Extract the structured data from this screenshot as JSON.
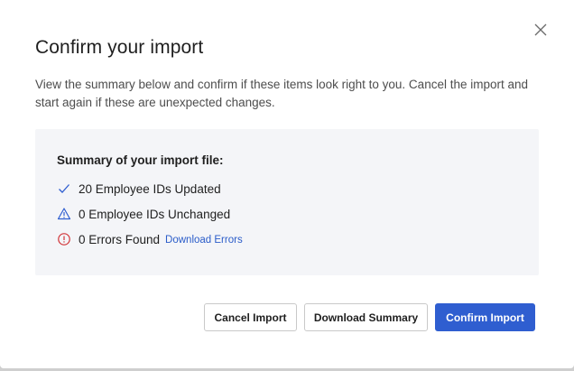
{
  "dialog": {
    "title": "Confirm your import",
    "description": "View the summary below and confirm if these items look right to you. Cancel the import and start again if these are unexpected changes.",
    "close_icon": "close-icon"
  },
  "summary": {
    "heading": "Summary of your import file:",
    "rows": [
      {
        "icon": "check-icon",
        "text": "20 Employee IDs Updated",
        "color": "#2f5ed0"
      },
      {
        "icon": "warning-icon",
        "text": "0 Employee IDs Unchanged",
        "color": "#2f5ed0"
      },
      {
        "icon": "error-icon",
        "text": "0 Errors Found",
        "color": "#d13438",
        "link": "Download Errors"
      }
    ]
  },
  "actions": {
    "cancel_label": "Cancel Import",
    "download_summary_label": "Download Summary",
    "confirm_label": "Confirm Import"
  },
  "colors": {
    "primary": "#2f5ed0",
    "link": "#2a5cc9",
    "error": "#d13438",
    "summary_bg": "#f4f5f8"
  }
}
